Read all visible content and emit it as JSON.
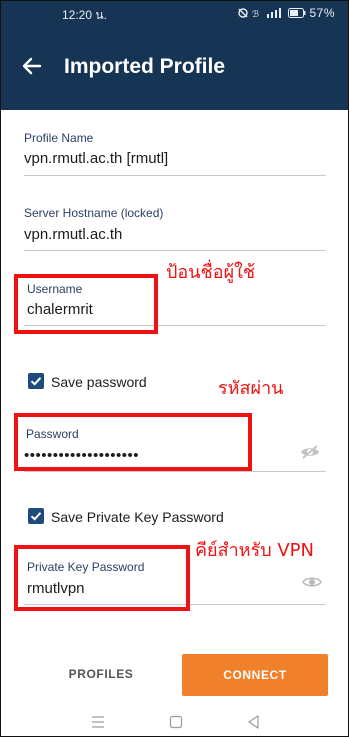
{
  "status_bar": {
    "time": "12:20 น.",
    "indicators": "🔕 ⁂ ᴵᴵ▮ ▭57%",
    "battery": "57%"
  },
  "app_bar": {
    "title": "Imported Profile",
    "back_icon": "arrow-left-icon",
    "background": "#163555"
  },
  "form": {
    "profile_name": {
      "label": "Profile Name",
      "value": "vpn.rmutl.ac.th [rmutl]"
    },
    "server_hostname": {
      "label": "Server Hostname (locked)",
      "value": "vpn.rmutl.ac.th"
    },
    "username": {
      "label": "Username",
      "value": "chalermrit"
    },
    "save_password": {
      "label": "Save password",
      "checked": true
    },
    "password": {
      "label": "Password",
      "value": "••••••••••••••••••••"
    },
    "save_private_key": {
      "label": "Save Private Key Password",
      "checked": true
    },
    "private_key_password": {
      "label": "Private Key Password",
      "value": "rmutlvpn"
    }
  },
  "annotations": {
    "username_note": "ป้อนชื่อผู้ใช้",
    "password_note": "รหัสผ่าน",
    "key_note": "คีย์สำหรับ VPN",
    "color": "#f01212"
  },
  "buttons": {
    "profiles": "PROFILES",
    "connect": "CONNECT",
    "connect_color": "#f0802a"
  },
  "nav_bar": {
    "icons": [
      "menu-icon",
      "home-icon",
      "back-triangle-icon"
    ]
  }
}
